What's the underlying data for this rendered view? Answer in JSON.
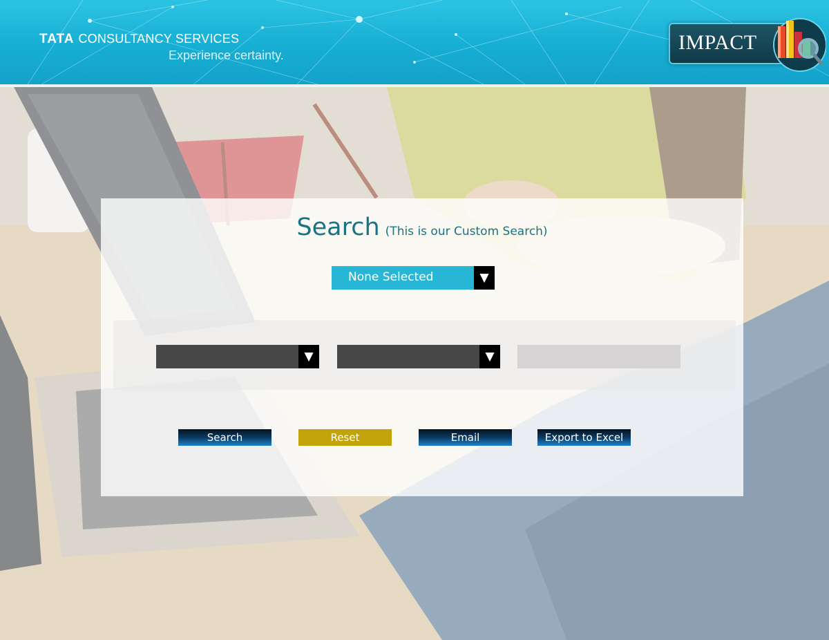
{
  "header": {
    "brand_tata": "TATA",
    "brand_name": "CONSULTANCY SERVICES",
    "tagline": "Experience certainty.",
    "app_logo_text": "IMPACT",
    "app_logo_icon": "bar-chart-magnifier-icon"
  },
  "search": {
    "title": "Search",
    "subtitle": "(This is our Custom Search)",
    "main_select": {
      "selected": "None Selected",
      "arrow": "▼"
    },
    "filters": {
      "select_1": {
        "selected": "",
        "arrow": "▼"
      },
      "select_2": {
        "selected": "",
        "arrow": "▼"
      },
      "text_input": {
        "value": ""
      }
    },
    "buttons": {
      "search": "Search",
      "reset": "Reset",
      "email": "Email",
      "export": "Export to Excel"
    }
  },
  "colors": {
    "header": "#17aed4",
    "title": "#1a7382",
    "main_select": "#28b6d6",
    "dark_select": "#474747",
    "reset_button": "#c2a40a",
    "blue_button": "#0b3a63"
  }
}
